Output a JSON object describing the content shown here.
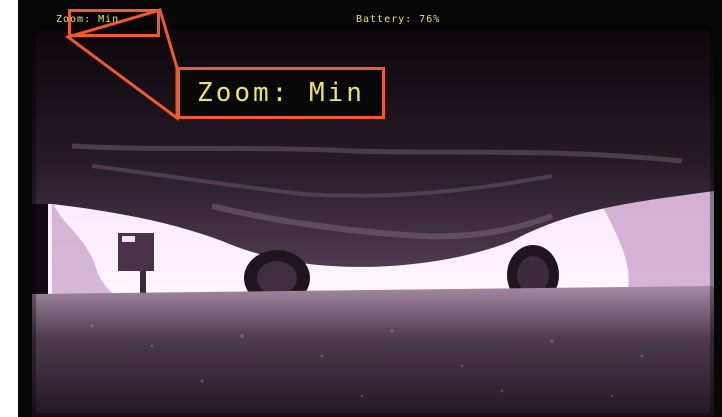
{
  "hud": {
    "zoom_text": "Zoom: Min",
    "battery_text": "Battery: 76%",
    "callout_text": "Zoom: Min"
  },
  "colors": {
    "hud_text": "#e8e36a",
    "annotation": "#ef5a2c",
    "frame_bg": "#070707"
  },
  "icons": [
    "camera-feed-scene",
    "zoom-callout-annotation"
  ]
}
